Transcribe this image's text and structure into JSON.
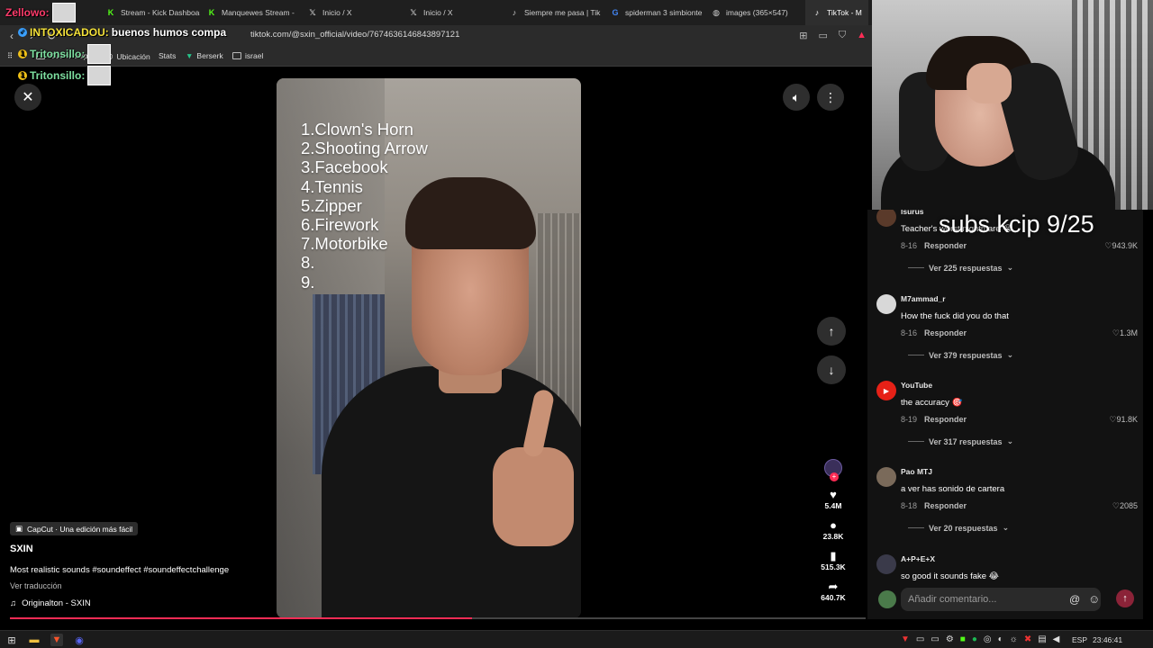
{
  "browser": {
    "tabs": [
      {
        "label": "Stream - Kick Dashboard",
        "icon": "kick-icon",
        "color": "#53fc18"
      },
      {
        "label": "Manquewes Stream -",
        "icon": "kick-icon",
        "color": "#53fc18"
      },
      {
        "label": "Inicio / X",
        "icon": "x-icon",
        "color": "#ffffff"
      },
      {
        "label": "Inicio / X",
        "icon": "x-icon",
        "color": "#ffffff"
      },
      {
        "label": "Siempre me pasa | Tik",
        "icon": "tiktok-icon",
        "color": "#ffffff"
      },
      {
        "label": "spiderman 3 simbionte",
        "icon": "google-icon",
        "color": "#4285f4"
      },
      {
        "label": "images (365×547)",
        "icon": "globe-icon",
        "color": "#cccccc"
      },
      {
        "label": "TikTok - M",
        "icon": "tiktok-icon",
        "color": "#ffffff"
      }
    ],
    "url": "tiktok.com/@sxin_official/video/7674636146843897121",
    "bookmarks": [
      "Nueva carpeta",
      "Ubicación",
      "Stats",
      "Berserk",
      "israel"
    ]
  },
  "chat": [
    {
      "user": "Zellowo:",
      "color": "#ff3b6b",
      "message": ""
    },
    {
      "user": "INTOXICADOU:",
      "color": "#f5e23a",
      "message": "buenos humos compa"
    },
    {
      "user": "Tritonsillo:",
      "color": "#7de0a0",
      "message": ""
    },
    {
      "user": "Tritonsillo:",
      "color": "#7de0a0",
      "message": ""
    }
  ],
  "video": {
    "list": [
      "1.Clown's Horn",
      "2.Shooting Arrow",
      "3.Facebook",
      "4.Tennis",
      "5.Zipper",
      "6.Firework",
      "7.Motorbike",
      "8.",
      "9."
    ],
    "progress": 0.54
  },
  "actions": {
    "likes": "5.4M",
    "comments": "23.8K",
    "saves": "515.3K",
    "shares": "640.7K"
  },
  "info": {
    "capcut": "CapCut · Una edición más fácil",
    "author": "SXIN",
    "caption": "Most realistic sounds #soundeffect #soundeffectchallenge",
    "translate": "Ver traducción",
    "music": "Originalton - SXIN"
  },
  "stream_overlay": "subs kcip 9/25",
  "comments": [
    {
      "user": "lsurus",
      "text": "Teacher's worst nightmare 😭",
      "date": "8-16",
      "reply": "Responder",
      "likes": "943.9K",
      "more": "Ver 225 respuestas"
    },
    {
      "user": "M7ammad_r",
      "text": "How the fuck did you do that",
      "date": "8-16",
      "reply": "Responder",
      "likes": "1.3M",
      "more": "Ver 379 respuestas"
    },
    {
      "user": "YouTube",
      "text": "the accuracy 🎯",
      "date": "8-19",
      "reply": "Responder",
      "likes": "91.8K",
      "more": "Ver 317 respuestas"
    },
    {
      "user": "Pao MTJ",
      "text": "a ver has sonido de cartera",
      "date": "8-18",
      "reply": "Responder",
      "likes": "2085",
      "more": "Ver 20 respuestas"
    },
    {
      "user": "A+P+E+X",
      "text": "so good it sounds fake 😂",
      "date": "",
      "reply": "",
      "likes": "",
      "more": ""
    }
  ],
  "comment_input": {
    "placeholder": "Añadir comentario..."
  },
  "taskbar": {
    "language": "ESP",
    "time": "23:46:41"
  },
  "colors": {
    "tiktok_red": "#fe2c55",
    "background": "#000000",
    "panel": "#121212"
  }
}
